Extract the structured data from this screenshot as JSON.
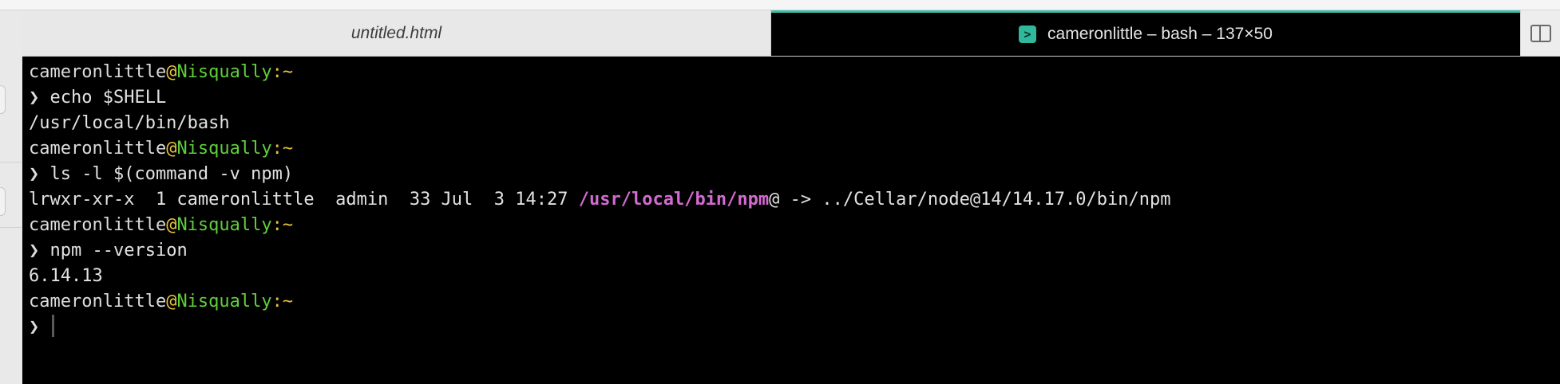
{
  "tabs": [
    {
      "label": "untitled.html",
      "active": false
    },
    {
      "label": "cameronlittle – bash – 137×50",
      "active": true,
      "icon": "terminal-icon"
    }
  ],
  "split_view_icon": "split-view-icon",
  "colors": {
    "terminal_bg": "#000000",
    "text": "#e2e2e2",
    "hostname": "#5fcf3a",
    "prompt_symbol": "#e8c33b",
    "symlink_path": "#d36bd1",
    "active_tab_accent": "#3fbfa7"
  },
  "terminal": {
    "user": "cameronlittle",
    "at": "@",
    "host": "Nisqually",
    "colon": ":",
    "tilde": "~",
    "arrow": "❯",
    "commands": {
      "cmd1": "echo $SHELL",
      "out1": "/usr/local/bin/bash",
      "cmd2": "ls -l $(command -v npm)",
      "out2_prefix": "lrwxr-xr-x  1 cameronlittle  admin  33 Jul  3 14:27 ",
      "out2_path": "/usr/local/bin/npm",
      "out2_suffix": "@ -> ../Cellar/node@14/14.17.0/bin/npm",
      "cmd3": "npm --version",
      "out3": "6.14.13"
    }
  }
}
